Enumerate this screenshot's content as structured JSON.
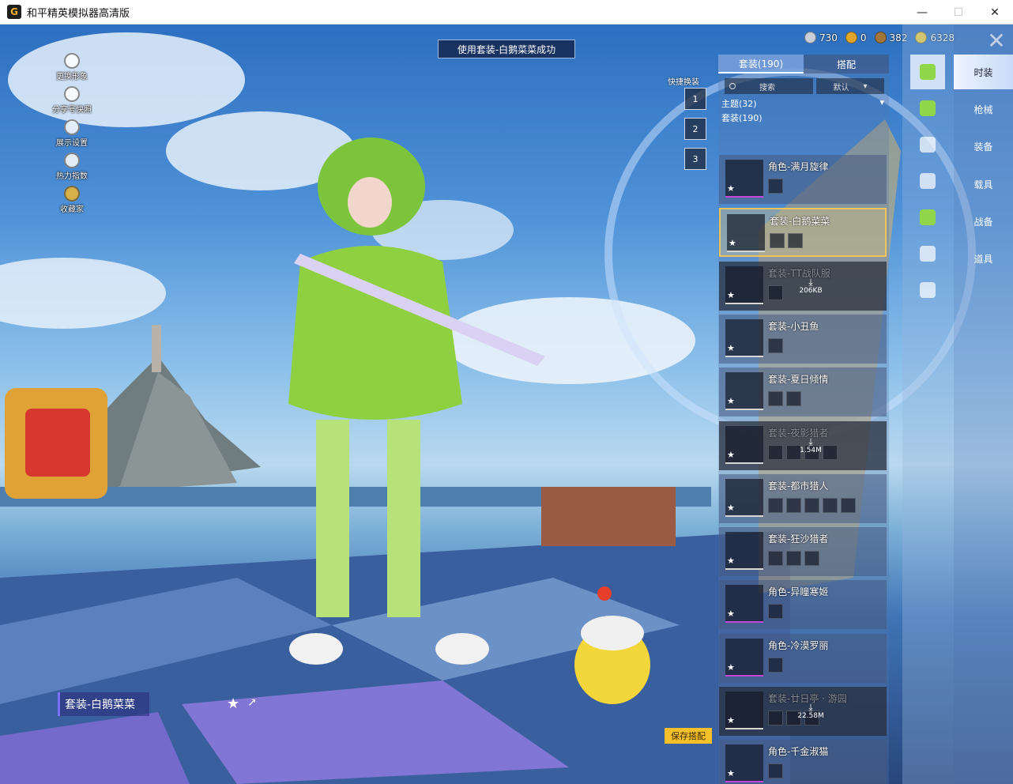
{
  "window": {
    "title": "和平精英模拟器高清版",
    "minimize": "—",
    "maximize": "☐",
    "close": "✕"
  },
  "toast": "使用套装-白鹅菜菜成功",
  "left_menu": [
    {
      "label": "更换形象",
      "icon": "avatar-icon"
    },
    {
      "label": "分享号快照",
      "icon": "share-icon"
    },
    {
      "label": "展示设置",
      "icon": "eye-icon"
    },
    {
      "label": "热力指数",
      "icon": "fire-icon"
    },
    {
      "label": "收藏家",
      "icon": "badge-icon"
    }
  ],
  "currency": [
    {
      "value": "730",
      "color": "#c9ced8"
    },
    {
      "value": "0",
      "color": "#e0a52a"
    },
    {
      "value": "382",
      "color": "#a2753a"
    },
    {
      "value": "6328",
      "color": "#f1cf3a"
    }
  ],
  "quick_swap": {
    "label": "快捷换装",
    "slots": [
      "1",
      "2",
      "3"
    ]
  },
  "panel": {
    "tabs": [
      "套装(190)",
      "搭配"
    ],
    "search_placeholder": "搜索",
    "sort": "默认",
    "theme": "主题(32)",
    "set_count": "套装(190)",
    "items": [
      {
        "name": "角色-满月旋律",
        "state": "normal",
        "rare": true,
        "subs": 1
      },
      {
        "name": "套装-白鹅菜菜",
        "state": "selected",
        "rare": false,
        "subs": 2
      },
      {
        "name": "套装-TT战队服",
        "state": "locked",
        "rare": false,
        "subs": 1,
        "download": "206KB"
      },
      {
        "name": "套装-小丑鱼",
        "state": "normal",
        "rare": false,
        "subs": 1
      },
      {
        "name": "套装-夏日倾情",
        "state": "normal",
        "rare": false,
        "subs": 2
      },
      {
        "name": "套装-夜影猎者",
        "state": "locked",
        "rare": false,
        "subs": 4,
        "download": "1.54M"
      },
      {
        "name": "套装-都市猎人",
        "state": "normal",
        "rare": false,
        "subs": 5
      },
      {
        "name": "套装-狂沙猎者",
        "state": "normal",
        "rare": false,
        "subs": 3
      },
      {
        "name": "角色-异瞳寒姬",
        "state": "normal",
        "rare": true,
        "subs": 1
      },
      {
        "name": "角色-冷漠罗丽",
        "state": "normal",
        "rare": true,
        "subs": 1
      },
      {
        "name": "套装-廿日亭 · 游园",
        "state": "locked",
        "rare": false,
        "subs": 3,
        "download": "22.58M"
      },
      {
        "name": "角色-千金淑猫",
        "state": "normal",
        "rare": true,
        "subs": 1
      }
    ]
  },
  "right_nav": [
    "时装",
    "枪械",
    "装备",
    "载具",
    "战备",
    "道具"
  ],
  "bottom": {
    "outfit_name": "套装-白鹅菜菜",
    "save": "保存搭配"
  }
}
